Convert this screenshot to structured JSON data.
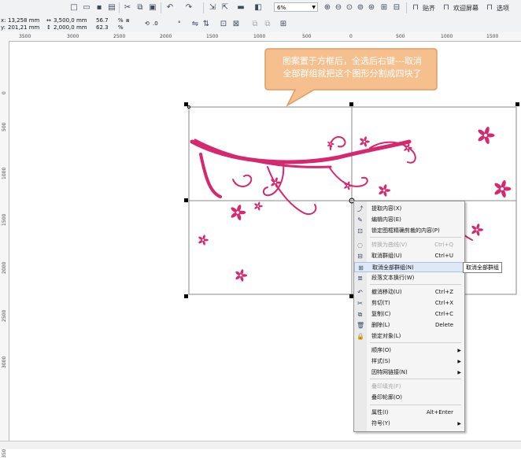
{
  "toolbar": {
    "zoom_value": "6%",
    "buttons": [
      "贴齐",
      "欢迎屏幕",
      "选项"
    ]
  },
  "propbar": {
    "x_label": "x:",
    "x_value": "13,258 mm",
    "y_label": "y:",
    "y_value": "201,21 mm",
    "width_value": "3,500,0 mm",
    "height_value": "2,000,0 mm",
    "scale_x": "56.7",
    "scale_y": "62.3",
    "pct_x": "%",
    "pct_y": "%",
    "rotation_value": ".0",
    "degree_symbol": "°"
  },
  "ruler": {
    "h_labels": [
      "3500",
      "3000",
      "2500",
      "2000",
      "1500",
      "1000",
      "500",
      "0",
      "500",
      "1000",
      "1500"
    ],
    "v_labels": [
      "0",
      "500",
      "1000",
      "1500",
      "2000",
      "2500",
      "3000",
      "3500"
    ]
  },
  "callout": {
    "line1": "图案置于方框后，全选后右键---取消",
    "line2": "全部群组就把这个图形分割成四块了",
    "fill_color": "#f5c08e",
    "border_color": "#e09a62"
  },
  "flower_color": "#d6286e",
  "context_menu": {
    "items": [
      {
        "icon": "extract-icon",
        "label": "提取内容(X)",
        "shortcut": "",
        "enabled": true
      },
      {
        "icon": "edit-contents-icon",
        "label": "编辑内容(E)",
        "shortcut": "",
        "enabled": true
      },
      {
        "icon": "lock-icon",
        "label": "锁定图框精确剪裁的内容(P)",
        "shortcut": "",
        "enabled": true
      },
      {
        "icon": "convert-curve-icon",
        "label": "转换为曲线(V)",
        "shortcut": "Ctrl+Q",
        "enabled": false
      },
      {
        "icon": "ungroup-icon",
        "label": "取消群组(U)",
        "shortcut": "Ctrl+U",
        "enabled": true
      },
      {
        "icon": "ungroup-all-icon",
        "label": "取消全部群组(N)",
        "shortcut": "",
        "enabled": true,
        "highlighted": true
      },
      {
        "icon": "text-wrap-icon",
        "label": "段落文本换行(W)",
        "shortcut": "",
        "enabled": true
      },
      {
        "icon": "undo-icon",
        "label": "撤消移动(U)",
        "shortcut": "Ctrl+Z",
        "enabled": true
      },
      {
        "icon": "cut-icon",
        "label": "剪切(T)",
        "shortcut": "Ctrl+X",
        "enabled": true
      },
      {
        "icon": "copy-icon",
        "label": "复制(C)",
        "shortcut": "Ctrl+C",
        "enabled": true
      },
      {
        "icon": "delete-icon",
        "label": "删除(L)",
        "shortcut": "Delete",
        "enabled": true
      },
      {
        "icon": "lock-object-icon",
        "label": "锁定对象(L)",
        "shortcut": "",
        "enabled": true
      },
      {
        "icon": "",
        "label": "顺序(O)",
        "shortcut": "",
        "enabled": true,
        "submenu": true
      },
      {
        "icon": "",
        "label": "样式(S)",
        "shortcut": "",
        "enabled": true,
        "submenu": true
      },
      {
        "icon": "",
        "label": "因特网链接(N)",
        "shortcut": "",
        "enabled": true,
        "submenu": true
      },
      {
        "icon": "",
        "label": "叠印填充(F)",
        "shortcut": "",
        "enabled": false
      },
      {
        "icon": "",
        "label": "叠印轮廓(O)",
        "shortcut": "",
        "enabled": true
      },
      {
        "icon": "",
        "label": "属性(I)",
        "shortcut": "Alt+Enter",
        "enabled": true
      },
      {
        "icon": "",
        "label": "符号(Y)",
        "shortcut": "",
        "enabled": true,
        "submenu": true
      }
    ],
    "tooltip": "取消全部群组"
  }
}
